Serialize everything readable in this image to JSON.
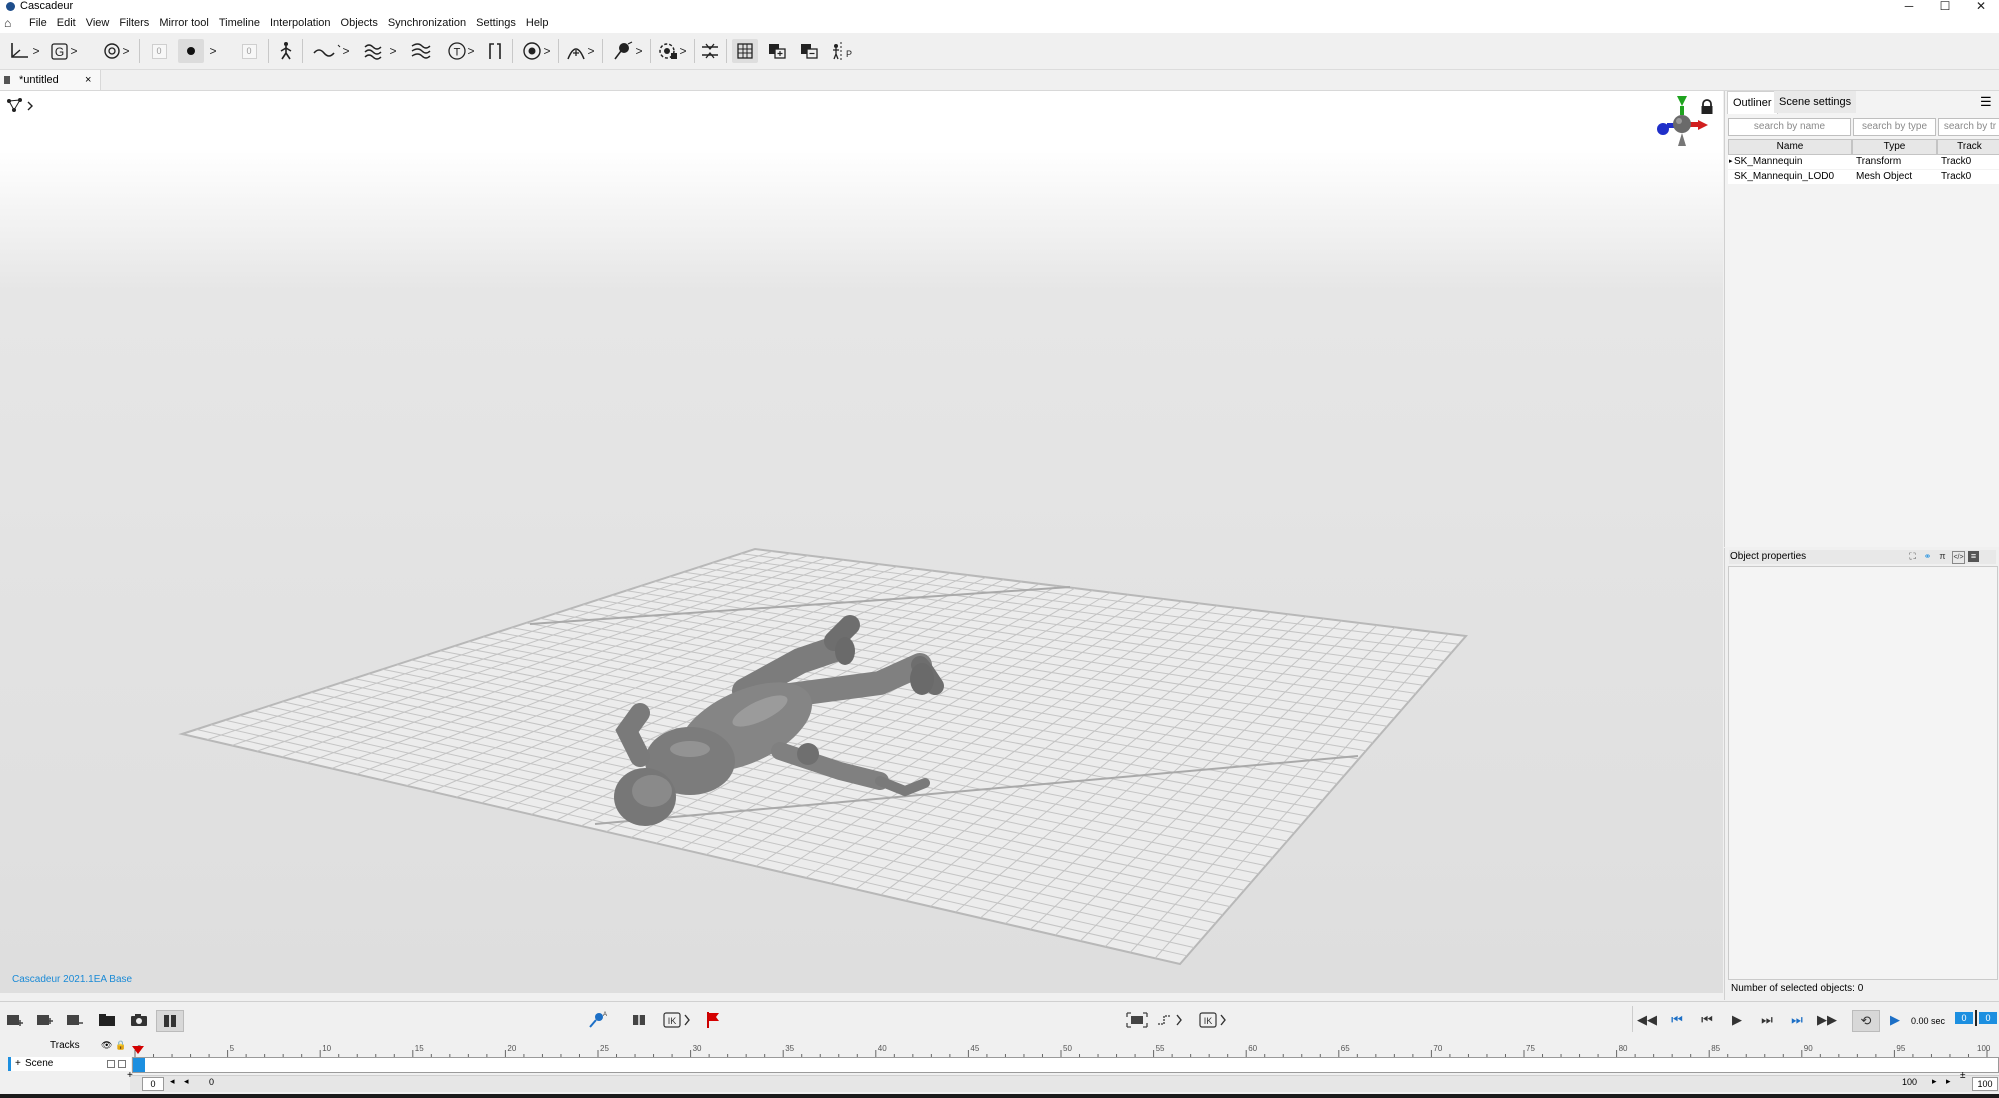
{
  "window": {
    "title": "Cascadeur",
    "minimize": "─",
    "maximize": "☐",
    "close": "✕"
  },
  "menu": [
    "File",
    "Edit",
    "View",
    "Filters",
    "Mirror tool",
    "Timeline",
    "Interpolation",
    "Objects",
    "Synchronization",
    "Settings",
    "Help"
  ],
  "toolbar": {
    "counter_a": "0",
    "counter_b": "0"
  },
  "tab": {
    "label": "*untitled",
    "close": "×"
  },
  "viewport": {
    "version": "Cascadeur 2021.1EA Base",
    "lock_icon": "lock-icon",
    "gizmo_icon": "axis-gizmo-icon"
  },
  "outliner": {
    "tabs": [
      "Outliner",
      "Scene settings"
    ],
    "search": {
      "name": "search by name",
      "type": "search by type",
      "track": "search by tr"
    },
    "columns": [
      "Name",
      "Type",
      "Track"
    ],
    "rows": [
      {
        "name": "SK_Mannequin",
        "type": "Transform",
        "track": "Track0",
        "expandable": true
      },
      {
        "name": "SK_Mannequin_LOD0",
        "type": "Mesh Object",
        "track": "Track0",
        "expandable": false
      }
    ]
  },
  "properties": {
    "title": "Object properties",
    "count_label": "Number of selected objects: 0"
  },
  "playback": {
    "time": "0.00 sec",
    "frame_a": "0",
    "frame_b": "0"
  },
  "timeline": {
    "tracks_label": "Tracks",
    "scene_track": "Scene",
    "ticks": [
      "0",
      "5",
      "10",
      "15",
      "20",
      "25",
      "30",
      "35",
      "40",
      "45",
      "50",
      "55",
      "60",
      "65",
      "70",
      "75",
      "80",
      "85",
      "90",
      "95",
      "100"
    ],
    "range_start": "0",
    "range_start_label": "0",
    "range_end_label": "100",
    "range_end": "100"
  },
  "colors": {
    "accent": "#1c8fe0",
    "version_text": "#1a8ad6",
    "gizmo_x": "#d11f1f",
    "gizmo_y": "#1fa31f",
    "gizmo_z": "#1f2fc9",
    "marker": "#d40000"
  }
}
